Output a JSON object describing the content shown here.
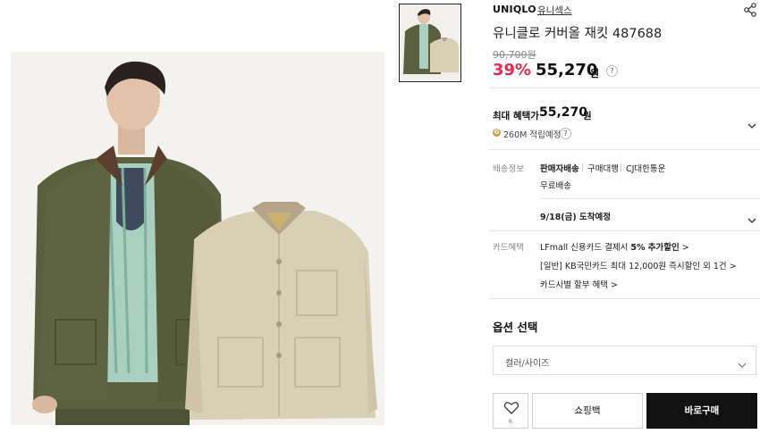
{
  "product": {
    "brand": "UNIQLO",
    "category": "유니섹스",
    "title": "유니클로 커버올 재킷 487688",
    "original_price": "90,700원",
    "discount": "39%",
    "price": "55,270",
    "currency": "원"
  },
  "benefits": {
    "max_label": "최대 혜택가",
    "max_price": "55,270",
    "currency": "원",
    "coin_symbol": "G",
    "points": "260M 적립예정"
  },
  "shipping": {
    "label": "배송정보",
    "options": [
      "판매자배송",
      "구매대행",
      "CJ대한통운"
    ],
    "fee": "무료배송",
    "arrival": "9/18(금) 도착예정"
  },
  "card": {
    "label": "카드혜택",
    "line1_prefix": "LFmall 신용카드 결제시 ",
    "line1_highlight": "5% 추가할인",
    "line1_suffix": " >",
    "line2": "[일반] KB국민카드 최대 12,000원 즉시할인 외 1건 >",
    "line3": "카드사별 할부 혜택 >"
  },
  "options": {
    "title": "옵션 선택",
    "select_placeholder": "컬러/사이즈"
  },
  "actions": {
    "wish_count": "6",
    "cart_label": "쇼핑백",
    "buy_label": "바로구매"
  },
  "colors": {
    "accent": "#e8294b",
    "buy_bg": "#111111",
    "jacket_olive": "#5a5f3d",
    "jacket_beige": "#d9cfb4",
    "shirt_stripe": "#9cc3b2"
  }
}
